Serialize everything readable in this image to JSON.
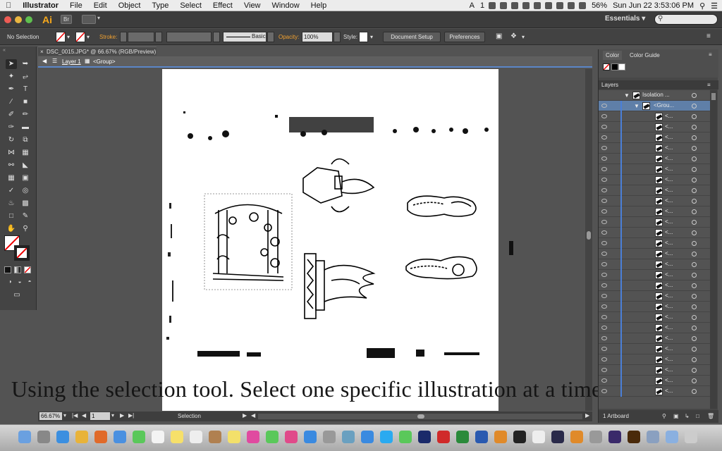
{
  "menubar": {
    "app": "Illustrator",
    "items": [
      "File",
      "Edit",
      "Object",
      "Type",
      "Select",
      "Effect",
      "View",
      "Window",
      "Help"
    ],
    "battery": "56%",
    "datetime": "Sun Jun 22  3:53:06 PM",
    "tray_num": "1"
  },
  "appbar": {
    "logo": "Ai",
    "bridge": "Br",
    "workspace": "Essentials",
    "workspace_caret": "▾"
  },
  "controlbar": {
    "selection": "No Selection",
    "stroke_label": "Stroke:",
    "brush": "Basic",
    "opacity_label": "Opacity:",
    "opacity_value": "100%",
    "style_label": "Style:",
    "document_setup": "Document Setup",
    "preferences": "Preferences"
  },
  "document": {
    "tab": "DSC_0015.JPG* @ 66.67% (RGB/Preview)",
    "layer": "Layer 1",
    "group": "<Group>"
  },
  "status": {
    "zoom": "66.67%",
    "artboard": "1",
    "tool": "Selection"
  },
  "panels": {
    "color_tab": "Color",
    "color_guide_tab": "Color Guide",
    "layers_title": "Layers",
    "rows": [
      {
        "name": "Isolation ...",
        "depth": 0
      },
      {
        "name": "<Grou...",
        "depth": 1
      },
      {
        "name": "<...",
        "depth": 2
      }
    ],
    "footer": "1 Artboard"
  },
  "caption": "Using the selection tool. Select one specific illustration at a time."
}
